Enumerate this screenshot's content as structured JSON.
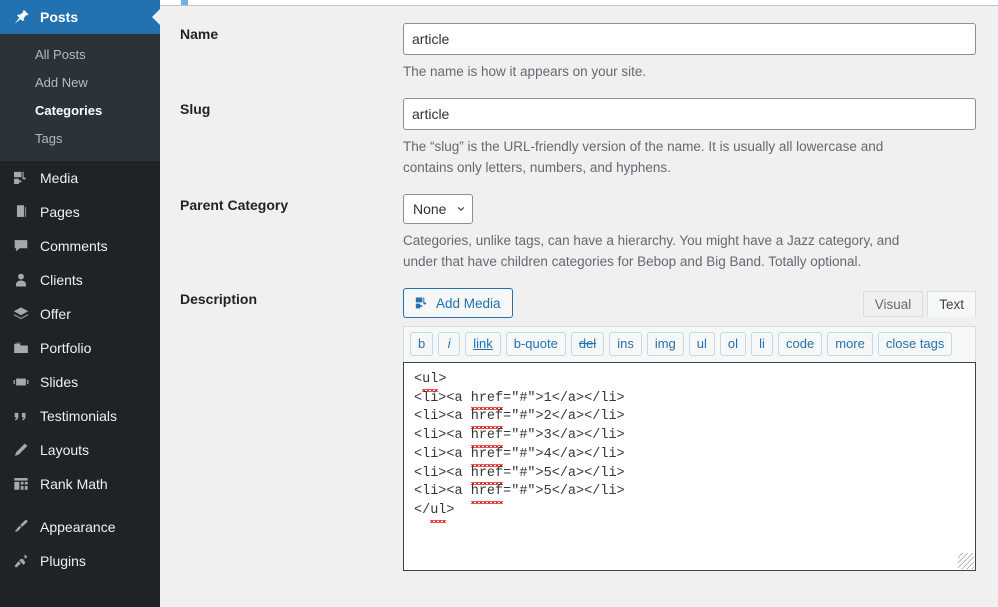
{
  "sidebar": {
    "active_item": "Posts",
    "accent_color": "#2271b1",
    "bg_color": "#1d2327",
    "submenu_bg_color": "#2c3338",
    "posts": {
      "label": "Posts",
      "icon": "pin-icon"
    },
    "submenu": [
      {
        "label": "All Posts",
        "current": false
      },
      {
        "label": "Add New",
        "current": false
      },
      {
        "label": "Categories",
        "current": true
      },
      {
        "label": "Tags",
        "current": false
      }
    ],
    "items": [
      {
        "label": "Media",
        "icon": "media-icon"
      },
      {
        "label": "Pages",
        "icon": "pages-icon"
      },
      {
        "label": "Comments",
        "icon": "comment-icon"
      },
      {
        "label": "Clients",
        "icon": "user-icon"
      },
      {
        "label": "Offer",
        "icon": "offer-stack-icon"
      },
      {
        "label": "Portfolio",
        "icon": "portfolio-folder-icon"
      },
      {
        "label": "Slides",
        "icon": "slides-film-icon"
      },
      {
        "label": "Testimonials",
        "icon": "quote-icon"
      },
      {
        "label": "Layouts",
        "icon": "pencil-icon"
      },
      {
        "label": "Rank Math",
        "icon": "bar-chart-icon"
      }
    ],
    "items_after_gap": [
      {
        "label": "Appearance",
        "icon": "paintbrush-icon"
      },
      {
        "label": "Plugins",
        "icon": "plug-icon"
      }
    ]
  },
  "form": {
    "name": {
      "label": "Name",
      "value": "article",
      "placeholder": "",
      "help": "The name is how it appears on your site."
    },
    "slug": {
      "label": "Slug",
      "value": "article",
      "placeholder": "",
      "help": "The “slug” is the URL-friendly version of the name. It is usually all lowercase and contains only letters, numbers, and hyphens."
    },
    "parent_category": {
      "label": "Parent Category",
      "selected": "None",
      "options": [
        "None"
      ],
      "help": "Categories, unlike tags, can have a hierarchy. You might have a Jazz category, and under that have children categories for Bebop and Big Band. Totally optional."
    },
    "description": {
      "label": "Description",
      "add_media_label": "Add Media",
      "add_media_icon": "media-icon",
      "tabs": [
        {
          "label": "Visual",
          "active": false
        },
        {
          "label": "Text",
          "active": true
        }
      ],
      "quicktags": [
        {
          "label": "b",
          "style": "bold"
        },
        {
          "label": "i",
          "style": "italic"
        },
        {
          "label": "link",
          "style": "underline"
        },
        {
          "label": "b-quote",
          "style": "plain"
        },
        {
          "label": "del",
          "style": "strike"
        },
        {
          "label": "ins",
          "style": "plain"
        },
        {
          "label": "img",
          "style": "plain"
        },
        {
          "label": "ul",
          "style": "plain"
        },
        {
          "label": "ol",
          "style": "plain"
        },
        {
          "label": "li",
          "style": "plain"
        },
        {
          "label": "code",
          "style": "plain"
        },
        {
          "label": "more",
          "style": "plain"
        },
        {
          "label": "close tags",
          "style": "plain"
        }
      ],
      "code_lines": [
        "<ul>",
        "<li><a href=\"#\">1</a></li>",
        "<li><a href=\"#\">2</a></li>",
        "<li><a href=\"#\">3</a></li>",
        "<li><a href=\"#\">4</a></li>",
        "<li><a href=\"#\">5</a></li>",
        "<li><a href=\"#\">5</a></li>",
        "</ul>"
      ]
    }
  }
}
